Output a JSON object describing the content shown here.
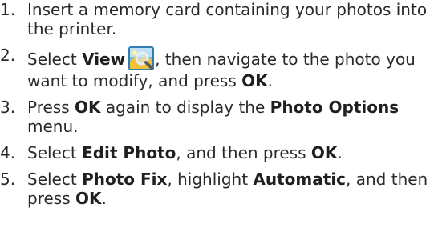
{
  "steps": [
    {
      "number": "1.",
      "parts": [
        "Insert a memory card containing your photos into the printer."
      ]
    },
    {
      "number": "2.",
      "parts": [
        "Select ",
        "View",
        ", then navigate to the photo you want to modify, and press ",
        "OK",
        "."
      ],
      "icon": "view-photos-icon"
    },
    {
      "number": "3.",
      "parts": [
        "Press ",
        "OK",
        " again to display the ",
        "Photo Options",
        " menu."
      ]
    },
    {
      "number": "4.",
      "parts": [
        "Select ",
        "Edit Photo",
        ", and then press ",
        "OK",
        "."
      ]
    },
    {
      "number": "5.",
      "parts": [
        "Select ",
        "Photo Fix",
        ", highlight ",
        "Automatic",
        ", and then press ",
        "OK",
        "."
      ]
    }
  ]
}
